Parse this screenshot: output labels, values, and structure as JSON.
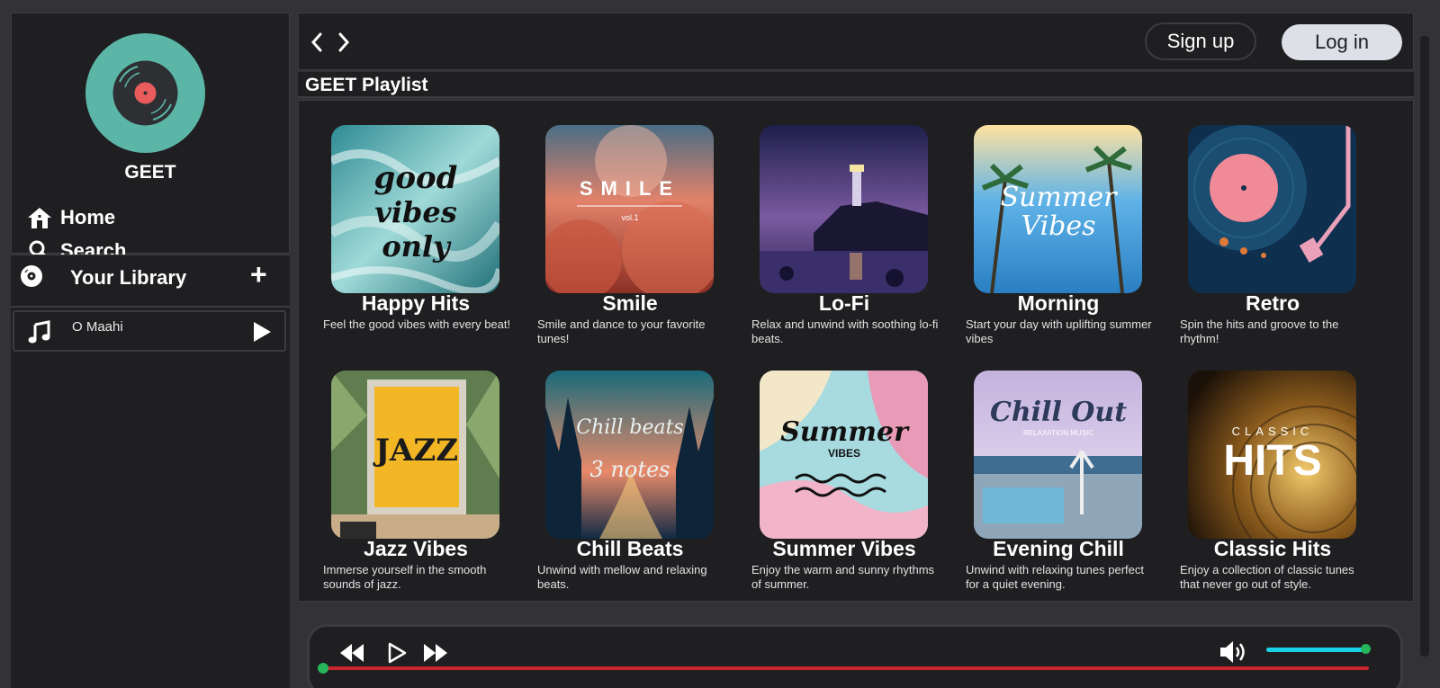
{
  "sidebar": {
    "brand": "GEET",
    "nav": [
      {
        "label": "Home",
        "icon": "home-icon"
      },
      {
        "label": "Search",
        "icon": "search-icon"
      }
    ],
    "library": {
      "title": "Your Library",
      "add_label": "+",
      "items": [
        {
          "label": "O Maahi",
          "icon": "music-note-icon"
        }
      ]
    }
  },
  "topbar": {
    "signup_label": "Sign up",
    "login_label": "Log in"
  },
  "section_title": "GEET Playlist",
  "playlists": [
    {
      "title": "Happy Hits",
      "desc": "Feel the good vibes with every beat!",
      "cover_text": "good vibes only"
    },
    {
      "title": "Smile",
      "desc": "Smile and dance to your favorite tunes!",
      "cover_text": "SMILE"
    },
    {
      "title": "Lo-Fi",
      "desc": "Relax and unwind with soothing lo-fi beats.",
      "cover_text": ""
    },
    {
      "title": "Morning",
      "desc": "Start your day with uplifting summer vibes",
      "cover_text": "Summer Vibes"
    },
    {
      "title": "Retro",
      "desc": "Spin the hits and groove to the rhythm!",
      "cover_text": ""
    },
    {
      "title": "Jazz Vibes",
      "desc": "Immerse yourself in the smooth sounds of jazz.",
      "cover_text": "JAZZ"
    },
    {
      "title": "Chill Beats",
      "desc": "Unwind with mellow and relaxing beats.",
      "cover_text": "Chill beats 3 notes"
    },
    {
      "title": "Summer Vibes",
      "desc": "Enjoy the warm and sunny rhythms of summer.",
      "cover_text": "Summer VIBES"
    },
    {
      "title": "Evening Chill",
      "desc": "Unwind with relaxing tunes perfect for a quiet evening.",
      "cover_text": "Chill Out"
    },
    {
      "title": "Classic Hits",
      "desc": "Enjoy a collection of classic tunes that never go out of style.",
      "cover_text": "HITS"
    }
  ],
  "player": {
    "volume": 1.0,
    "progress": 0.0
  },
  "colors": {
    "panel": "#1f1e21",
    "background": "#333235",
    "accent_logo": "#5cb6a8",
    "seek": "#c7262d",
    "volume": "#19d3e8",
    "knob": "#25b55a"
  }
}
